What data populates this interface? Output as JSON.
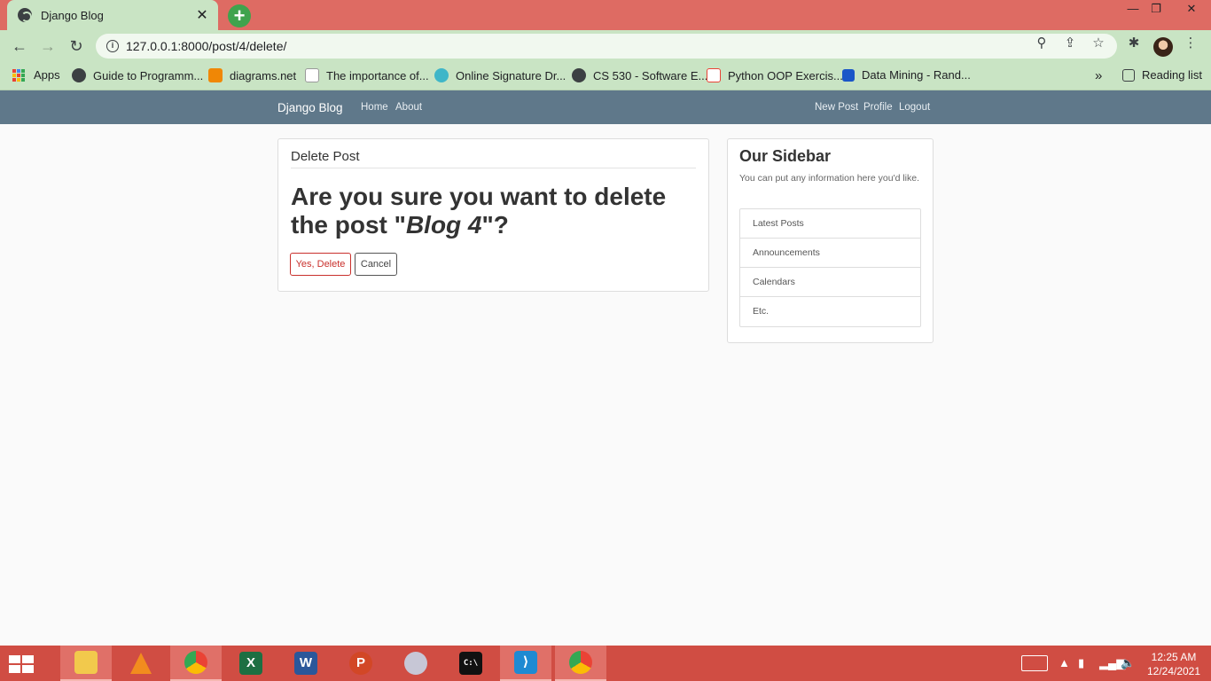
{
  "browser": {
    "tab_title": "Django Blog",
    "tab_close": "✕",
    "new_tab": "+",
    "url": "127.0.0.1:8000/post/4/delete/",
    "window_controls": {
      "minimize": "—",
      "restore": "❐",
      "close": "✕"
    }
  },
  "bookmarks": {
    "items": [
      {
        "label": "Apps"
      },
      {
        "label": "Guide to Programm..."
      },
      {
        "label": "diagrams.net"
      },
      {
        "label": "The importance of..."
      },
      {
        "label": "Online Signature Dr..."
      },
      {
        "label": "CS 530 - Software E..."
      },
      {
        "label": "Python OOP Exercis..."
      },
      {
        "label": "Data Mining - Rand..."
      }
    ],
    "overflow": "»",
    "reading_list": "Reading list"
  },
  "site_nav": {
    "brand": "Django Blog",
    "left_links": [
      "Home",
      "About"
    ],
    "right_links": [
      "New Post",
      "Profile",
      "Logout"
    ]
  },
  "main": {
    "legend": "Delete Post",
    "question_prefix": "Are you sure you want to delete the post \"",
    "post_title": "Blog 4",
    "question_suffix": "\"?",
    "confirm_button": "Yes, Delete",
    "cancel_button": "Cancel"
  },
  "sidebar": {
    "title": "Our Sidebar",
    "text": "You can put any information here you'd like.",
    "items": [
      "Latest Posts",
      "Announcements",
      "Calendars",
      "Etc."
    ]
  },
  "taskbar": {
    "time": "12:25 AM",
    "date": "12/24/2021"
  },
  "colors": {
    "tabbar": "#de6b63",
    "toolbar": "#c9e4c4",
    "navbar": "#5f788a",
    "danger": "#c9302c",
    "taskbar": "#d04d43"
  }
}
